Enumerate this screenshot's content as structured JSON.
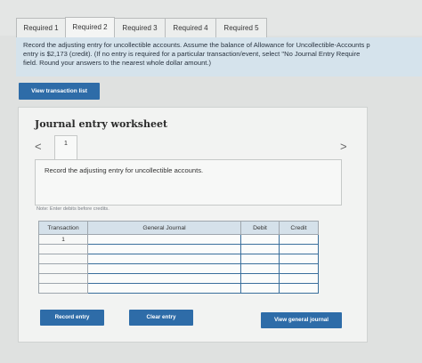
{
  "tabs": [
    {
      "label": "Required 1",
      "active": false
    },
    {
      "label": "Required 2",
      "active": true
    },
    {
      "label": "Required 3",
      "active": false
    },
    {
      "label": "Required 4",
      "active": false
    },
    {
      "label": "Required 5",
      "active": false
    }
  ],
  "instruction": {
    "line1": "Record the adjusting entry for uncollectible accounts. Assume the balance of Allowance for Uncollectible-Accounts p",
    "line2": "entry is $2,173 (credit). (If no entry is required for a particular transaction/event, select \"No Journal Entry Require",
    "line3": "field. Round your answers to the nearest whole dollar amount.)"
  },
  "view_transaction_button": "View transaction list",
  "worksheet": {
    "title": "Journal entry worksheet",
    "prev_arrow": "<",
    "next_arrow": ">",
    "page_number": "1",
    "description": "Record the adjusting entry for uncollectible accounts.",
    "note": "Note: Enter debits before credits."
  },
  "journal_table": {
    "headers": [
      "Transaction",
      "General Journal",
      "Debit",
      "Credit"
    ],
    "rows": [
      [
        "1",
        "",
        "",
        ""
      ],
      [
        "",
        "",
        "",
        ""
      ],
      [
        "",
        "",
        "",
        ""
      ],
      [
        "",
        "",
        "",
        ""
      ],
      [
        "",
        "",
        "",
        ""
      ],
      [
        "",
        "",
        "",
        ""
      ]
    ]
  },
  "buttons": {
    "record_entry": "Record entry",
    "clear_entry": "Clear entry",
    "view_general_journal": "View general journal"
  },
  "colors": {
    "accent_blue": "#2e6ca8",
    "instruction_bg": "#d5e3ec",
    "table_header_bg": "#d5e1ea"
  }
}
